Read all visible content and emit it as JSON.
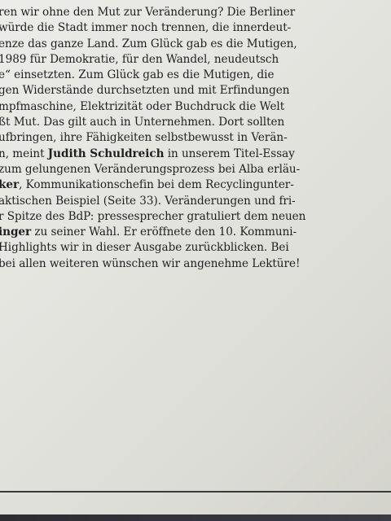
{
  "paragraph": {
    "lines": [
      {
        "segments": [
          {
            "text": "ren wir ohne den Mut zur Veränderung? Die Berliner",
            "bold": false
          }
        ]
      },
      {
        "segments": [
          {
            "text": "würde die Stadt immer noch trennen, die innerdeut-",
            "bold": false
          }
        ]
      },
      {
        "segments": [
          {
            "text": "enze das ganze Land. Zum Glück gab es die Mutigen,",
            "bold": false
          }
        ]
      },
      {
        "segments": [
          {
            "text": "1989 für Demokratie, für den Wandel, neudeutsch",
            "bold": false
          }
        ]
      },
      {
        "segments": [
          {
            "text": "e“ einsetzten. Zum Glück gab es die Mutigen, die",
            "bold": false
          }
        ]
      },
      {
        "segments": [
          {
            "text": "gen Widerstände durchsetzten und mit Erfindungen",
            "bold": false
          }
        ]
      },
      {
        "segments": [
          {
            "text": "mpfmaschine, Elektrizität oder Buchdruck die Welt",
            "bold": false
          }
        ]
      },
      {
        "segments": [
          {
            "text": "ßt Mut. Das gilt auch in Unternehmen. Dort sollten",
            "bold": false
          }
        ]
      },
      {
        "segments": [
          {
            "text": "ufbringen, ihre Fähigkeiten selbstbewusst in Verän-",
            "bold": false
          }
        ]
      },
      {
        "segments": [
          {
            "text": "n, meint ",
            "bold": false
          },
          {
            "text": "Judith Schuldreich",
            "bold": true
          },
          {
            "text": " in unserem Titel-Essay",
            "bold": false
          }
        ]
      },
      {
        "segments": [
          {
            "text": "zum gelungenen Veränderungsprozess bei Alba erläu-",
            "bold": false
          }
        ]
      },
      {
        "segments": [
          {
            "text": "ker",
            "bold": true
          },
          {
            "text": ", Kommunikationschefin bei dem Recyclingunter-",
            "bold": false
          }
        ]
      },
      {
        "segments": [
          {
            "text": "aktischen Beispiel (Seite 33). Veränderungen und fri-",
            "bold": false
          }
        ]
      },
      {
        "segments": [
          {
            "text": "r Spitze des BdP: pressesprecher gratuliert dem neuen",
            "bold": false
          }
        ]
      },
      {
        "segments": [
          {
            "text": "inger",
            "bold": true
          },
          {
            "text": " zu seiner Wahl. Er eröffnete den 10. Kommuni-",
            "bold": false
          }
        ]
      },
      {
        "segments": [
          {
            "text": "Highlights wir in dieser Ausgabe zurückblicken. Bei",
            "bold": false
          }
        ]
      },
      {
        "segments": [
          {
            "text": "bei allen weiteren wünschen wir angenehme Lektüre!",
            "bold": false
          }
        ]
      }
    ]
  }
}
